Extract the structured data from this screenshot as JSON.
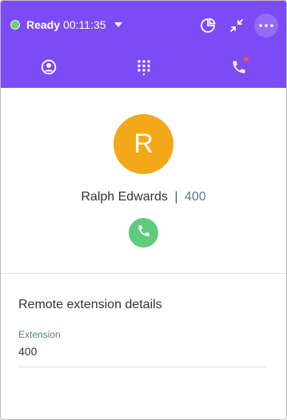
{
  "header": {
    "status_label": "Ready",
    "status_time": "00:11:35",
    "status_color": "#6fcf6b",
    "background_color": "#7b4cf5",
    "icons": {
      "status_menu": "caret-down-icon",
      "stats": "pie-chart-icon",
      "minimize": "collapse-icon",
      "more": "more-horizontal-icon"
    }
  },
  "tabs": [
    {
      "name": "contacts",
      "icon": "user-circle-icon"
    },
    {
      "name": "dialpad",
      "icon": "dialpad-icon"
    },
    {
      "name": "calls",
      "icon": "phone-icon",
      "badge": true
    }
  ],
  "contact": {
    "avatar_initial": "R",
    "avatar_color": "#f2a818",
    "name": "Ralph Edwards",
    "separator": "|",
    "extension": "400",
    "call_button_color": "#5fcc7c"
  },
  "details": {
    "title": "Remote extension details",
    "extension_label": "Extension",
    "extension_value": "400"
  }
}
